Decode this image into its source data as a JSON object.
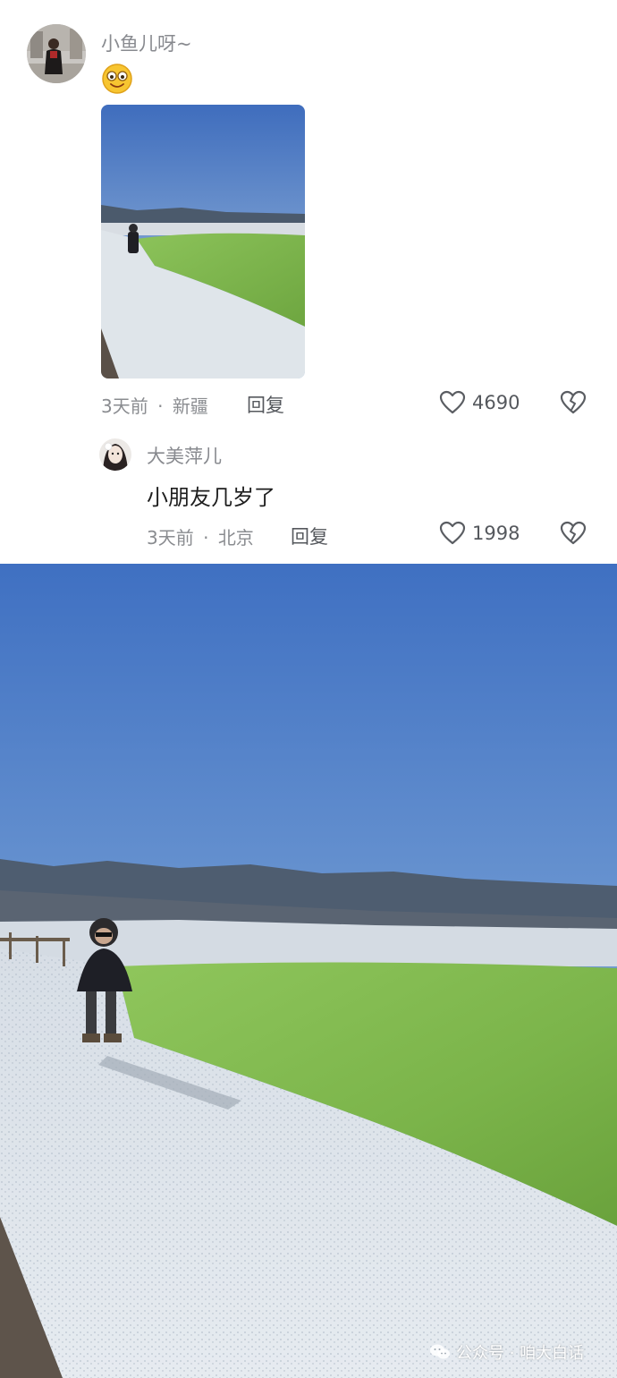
{
  "comment": {
    "username": "小鱼儿呀~",
    "emoji": "face-with-glasses-emoji",
    "time": "3天前",
    "separator": "·",
    "location": "新疆",
    "reply_label": "回复",
    "likes": "4690",
    "image_alt": "child standing by green salt lake"
  },
  "reply": {
    "username": "大美萍儿",
    "text": "小朋友几岁了",
    "time": "3天前",
    "separator": "·",
    "location": "北京",
    "reply_label": "回复",
    "likes": "1998"
  },
  "watermark": {
    "text": "公众号 · 咱大白话",
    "icon": "wechat-icon"
  },
  "icons": {
    "like": "heart-outline-icon",
    "dislike": "broken-heart-icon"
  },
  "colors": {
    "sky_top": "#3f6fbf",
    "lake": "#7fb64a",
    "salt": "#dfe6ee"
  }
}
